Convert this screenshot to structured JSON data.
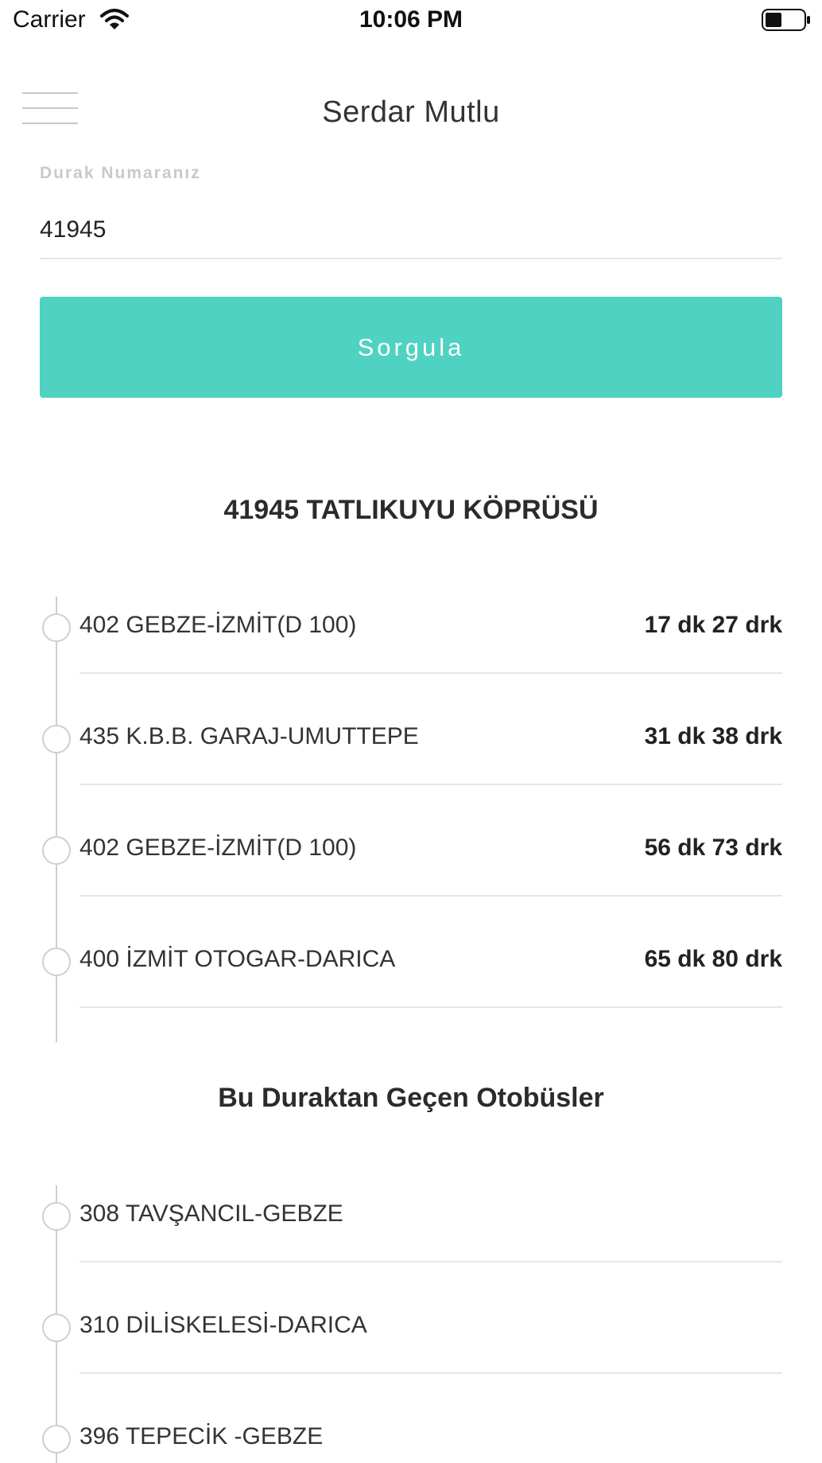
{
  "status_bar": {
    "carrier": "Carrier",
    "time": "10:06 PM"
  },
  "header": {
    "title": "Serdar Mutlu"
  },
  "form": {
    "label": "Durak Numaranız",
    "stop_number": "41945",
    "button_label": "Sorgula",
    "accent_color": "#50d2c2"
  },
  "stop": {
    "title": "41945 TATLIKUYU KÖPRÜSÜ",
    "arrivals": [
      {
        "route": "402 GEBZE-İZMİT(D 100)",
        "eta": "17 dk 27 drk"
      },
      {
        "route": "435 K.B.B. GARAJ-UMUTTEPE",
        "eta": "31 dk 38 drk"
      },
      {
        "route": "402 GEBZE-İZMİT(D 100)",
        "eta": "56 dk 73 drk"
      },
      {
        "route": "400 İZMİT OTOGAR-DARICA",
        "eta": "65 dk 80 drk"
      }
    ]
  },
  "passing_buses": {
    "title": "Bu Duraktan Geçen Otobüsler",
    "items": [
      {
        "route": "308 TAVŞANCIL-GEBZE"
      },
      {
        "route": "310 DİLİSKELESİ-DARICA"
      },
      {
        "route": "396 TEPECİK -GEBZE"
      }
    ]
  }
}
